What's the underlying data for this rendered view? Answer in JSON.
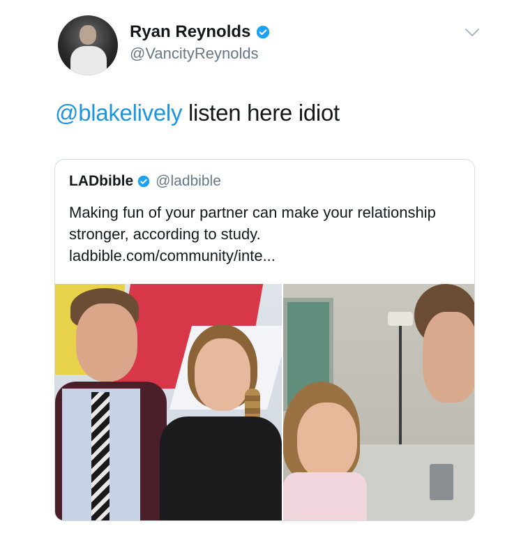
{
  "tweet": {
    "author_name": "Ryan Reynolds",
    "author_handle": "@VancityReynolds",
    "mention": "@blakelively",
    "body": " listen here idiot"
  },
  "quoted_tweet": {
    "author_name": "LADbible",
    "author_handle": "@ladbible",
    "text": "Making fun of your partner can make your relationship stronger, according to study. ladbible.com/community/inte..."
  },
  "icons": {
    "verified": "verified-badge-icon",
    "chevron": "chevron-down-icon"
  },
  "colors": {
    "verified_blue": "#1da1f2",
    "mention_blue": "#1b95e0",
    "secondary_text": "#657786"
  }
}
